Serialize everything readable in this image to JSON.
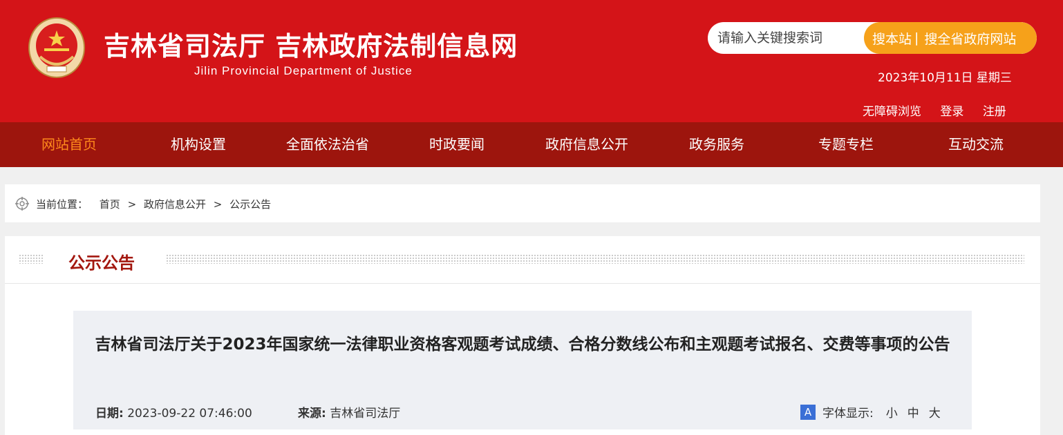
{
  "header": {
    "title": "吉林省司法厅  吉林政府法制信息网",
    "subtitle": "Jilin Provincial Department of Justice",
    "date": "2023年10月11日 星期三",
    "links": [
      "无障碍浏览",
      "登录",
      "注册"
    ],
    "search": {
      "placeholder": "请输入关键搜索词",
      "search_site": "搜本站",
      "separator": "|",
      "search_province": "搜全省政府网站"
    },
    "brand_color": "#d41418"
  },
  "nav": {
    "items": [
      "网站首页",
      "机构设置",
      "全面依法治省",
      "时政要闻",
      "政府信息公开",
      "政务服务",
      "专题专栏",
      "互动交流"
    ],
    "active_index": 0,
    "active_color": "#ff8a1c"
  },
  "breadcrumb": {
    "label": "当前位置：",
    "items": [
      "首页",
      "政府信息公开",
      "公示公告"
    ],
    "separator": ">"
  },
  "section": {
    "title": "公示公告"
  },
  "article": {
    "title": "吉林省司法厅关于2023年国家统一法律职业资格客观题考试成绩、合格分数线公布和主观题考试报名、交费等事项的公告",
    "date_label": "日期:",
    "date_value": "2023-09-22 07:46:00",
    "source_label": "来源:",
    "source_value": "吉林省司法厅",
    "font_icon": "A",
    "font_label": "字体显示:",
    "font_sizes": [
      "小",
      "中",
      "大"
    ]
  }
}
